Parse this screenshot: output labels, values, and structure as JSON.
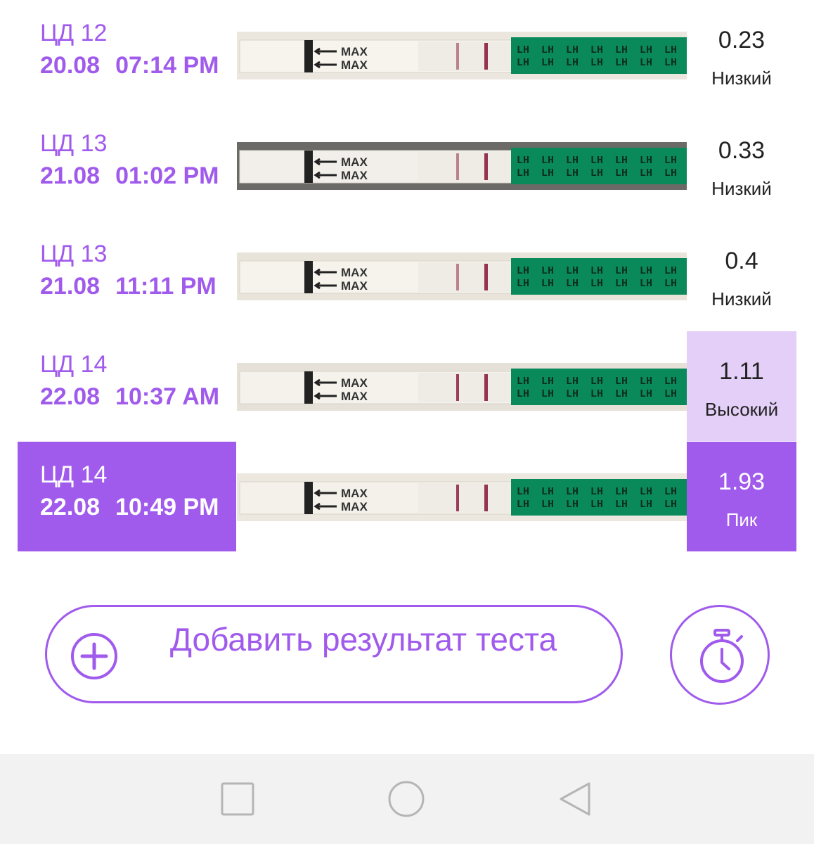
{
  "records": [
    {
      "cycle_day": "ЦД 12",
      "date": "20.08",
      "time": "07:14 PM",
      "value": "0.23",
      "level": "Низкий",
      "state": "low"
    },
    {
      "cycle_day": "ЦД 13",
      "date": "21.08",
      "time": "01:02 PM",
      "value": "0.33",
      "level": "Низкий",
      "state": "low"
    },
    {
      "cycle_day": "ЦД 13",
      "date": "21.08",
      "time": "11:11 PM",
      "value": "0.4",
      "level": "Низкий",
      "state": "low"
    },
    {
      "cycle_day": "ЦД 14",
      "date": "22.08",
      "time": "10:37 AM",
      "value": "1.11",
      "level": "Высокий",
      "state": "high"
    },
    {
      "cycle_day": "ЦД 14",
      "date": "22.08",
      "time": "10:49 PM",
      "value": "1.93",
      "level": "Пик",
      "state": "peak",
      "selected": true
    }
  ],
  "strip": {
    "max_text": "MAX",
    "lh_text": "LH"
  },
  "add_result_label": "Добавить результат теста",
  "icons": {
    "add": "plus-circle-icon",
    "timer": "stopwatch-icon",
    "nav_recent": "square-icon",
    "nav_home": "circle-icon",
    "nav_back": "triangle-back-icon"
  },
  "colors": {
    "accent": "#a05aec",
    "high_bg": "#e4cff8",
    "strip_green": "#0a8a5a",
    "strip_line": "#8e2a4a",
    "navbar_bg": "#f2f2f2"
  }
}
